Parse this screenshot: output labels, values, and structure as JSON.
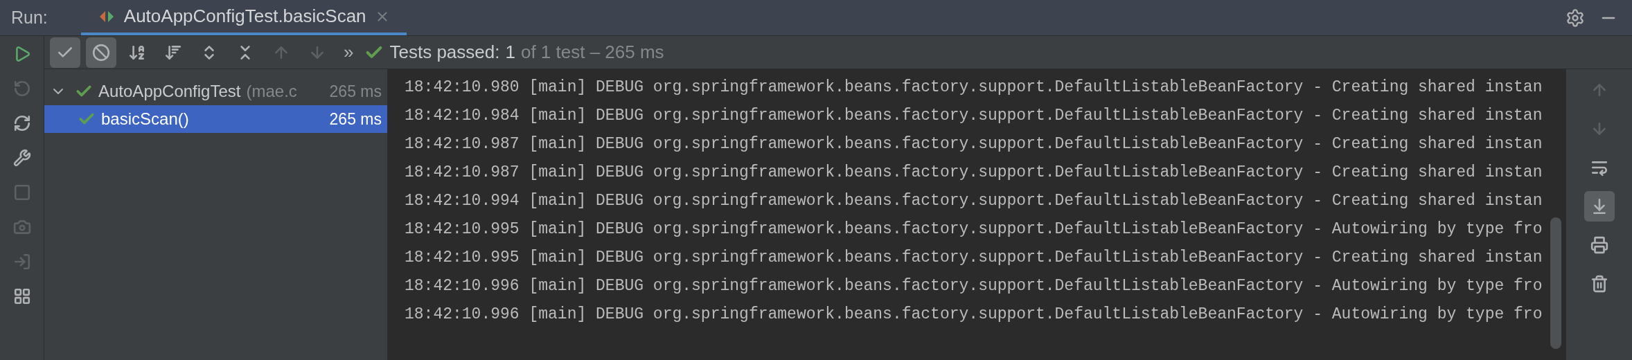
{
  "header": {
    "label": "Run:",
    "tabs": [
      {
        "label": "AutoAppConfigTest.basicScan",
        "selected": true
      }
    ]
  },
  "side_tools": [
    {
      "kind": "rerun",
      "disabled": false
    },
    {
      "kind": "rerun-failed",
      "disabled": true
    },
    {
      "kind": "toggle-auto",
      "disabled": false
    },
    {
      "kind": "settings",
      "disabled": false
    },
    {
      "kind": "stop",
      "disabled": true
    },
    {
      "kind": "snapshot",
      "disabled": true
    },
    {
      "kind": "export",
      "disabled": true
    },
    {
      "kind": "layout",
      "disabled": false
    }
  ],
  "toolbar": [
    {
      "kind": "show-passed",
      "selected": true,
      "disabled": false
    },
    {
      "kind": "show-ignored",
      "selected": true,
      "disabled": false
    },
    {
      "kind": "sort-alpha",
      "selected": false,
      "disabled": false
    },
    {
      "kind": "sort-duration",
      "selected": false,
      "disabled": false
    },
    {
      "kind": "expand-all",
      "selected": false,
      "disabled": false
    },
    {
      "kind": "collapse-all",
      "selected": false,
      "disabled": false
    },
    {
      "kind": "prev",
      "selected": false,
      "disabled": true
    },
    {
      "kind": "next",
      "selected": false,
      "disabled": true
    }
  ],
  "more": "»",
  "status": {
    "label": "Tests passed:",
    "count": "1",
    "detail": "of 1 test – 265 ms"
  },
  "tree": [
    {
      "name": "AutoAppConfigTest",
      "detail": "(mae.c",
      "duration": "265 ms",
      "expanded": true,
      "selected": false,
      "children": [
        {
          "name": "basicScan()",
          "duration": "265 ms",
          "selected": true
        }
      ]
    }
  ],
  "console": {
    "lines": [
      "18:42:10.980 [main] DEBUG org.springframework.beans.factory.support.DefaultListableBeanFactory - Creating shared instan",
      "18:42:10.984 [main] DEBUG org.springframework.beans.factory.support.DefaultListableBeanFactory - Creating shared instan",
      "18:42:10.987 [main] DEBUG org.springframework.beans.factory.support.DefaultListableBeanFactory - Creating shared instan",
      "18:42:10.987 [main] DEBUG org.springframework.beans.factory.support.DefaultListableBeanFactory - Creating shared instan",
      "18:42:10.994 [main] DEBUG org.springframework.beans.factory.support.DefaultListableBeanFactory - Creating shared instan",
      "18:42:10.995 [main] DEBUG org.springframework.beans.factory.support.DefaultListableBeanFactory - Autowiring by type fro",
      "18:42:10.995 [main] DEBUG org.springframework.beans.factory.support.DefaultListableBeanFactory - Creating shared instan",
      "18:42:10.996 [main] DEBUG org.springframework.beans.factory.support.DefaultListableBeanFactory - Autowiring by type fro",
      "18:42:10.996 [main] DEBUG org.springframework.beans.factory.support.DefaultListableBeanFactory - Autowiring by type fro"
    ]
  },
  "console_tools": [
    {
      "kind": "up",
      "selected": false,
      "disabled": true
    },
    {
      "kind": "down",
      "selected": false,
      "disabled": true
    },
    {
      "kind": "wrap",
      "selected": false,
      "disabled": false
    },
    {
      "kind": "scroll-end",
      "selected": true,
      "disabled": false
    },
    {
      "kind": "print",
      "selected": false,
      "disabled": false
    },
    {
      "kind": "clear",
      "selected": false,
      "disabled": false
    }
  ]
}
